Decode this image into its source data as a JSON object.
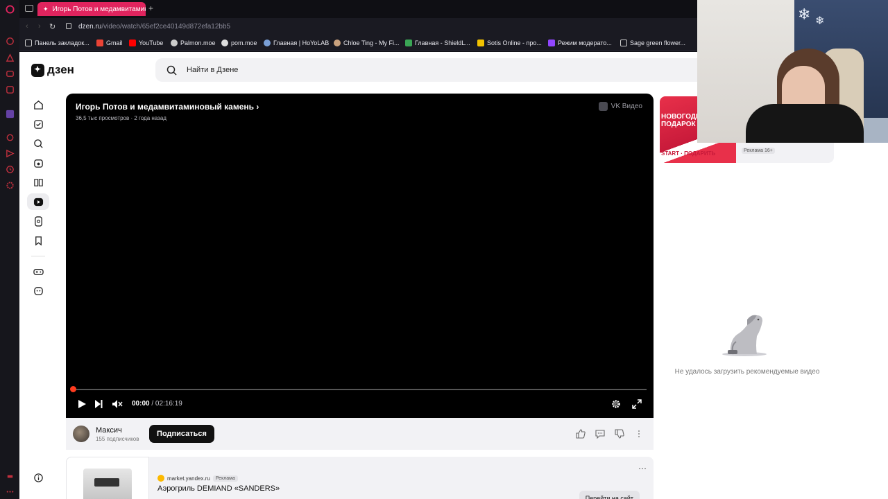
{
  "browser": {
    "active_tab_title": "Игорь Потов и медамвитамин",
    "new_tab_symbol": "+",
    "url_host": "dzen.ru",
    "url_path": "/video/watch/65ef2ce40149d872efa12bb5",
    "accent_color": "#e0245e"
  },
  "bookmarks": [
    {
      "label": "Панель закладок...",
      "icon": "folder-icon"
    },
    {
      "label": "Gmail",
      "icon": "gmail-icon"
    },
    {
      "label": "YouTube",
      "icon": "youtube-icon"
    },
    {
      "label": "Palmon.moe",
      "icon": "palmon-icon"
    },
    {
      "label": "pom.moe",
      "icon": "pom-icon"
    },
    {
      "label": "Главная | HoYoLAB",
      "icon": "hoyolab-icon"
    },
    {
      "label": "Chloe Ting - My Fi...",
      "icon": "chloe-icon"
    },
    {
      "label": "Главная - ShieldL...",
      "icon": "shield-icon"
    },
    {
      "label": "Sotis Online - про...",
      "icon": "sotis-icon"
    },
    {
      "label": "Режим модерато...",
      "icon": "twitch-icon"
    },
    {
      "label": "Sage green flower...",
      "icon": "page-icon"
    }
  ],
  "header": {
    "logo_text": "дзен",
    "search_placeholder": "Найти в Дзене"
  },
  "player": {
    "title": "Игорь Потов и медамвитаминовый камень",
    "meta": "36,5 тыс просмотров · 2 года назад",
    "source_label": "VK Видео",
    "current_time": "00:00",
    "duration": "/ 02:16:19",
    "progress": 0
  },
  "channel": {
    "name": "Максич",
    "subscribers": "155 подписчиков",
    "subscribe_label": "Подписаться"
  },
  "ad": {
    "source": "market.yandex.ru",
    "badge": "Реклама",
    "title": "Аэрогриль DEMIAND «SANDERS»",
    "cta": "Перейти на сайт",
    "more": "⋯"
  },
  "banner": {
    "headline": "НОВОГОДНИ ПОДАРОК",
    "footer": "START · ПОДАРИТЬ",
    "label": "Реклама 16+"
  },
  "recommendations": {
    "empty_text": "Не удалось загрузить рекомендуемые видео"
  }
}
